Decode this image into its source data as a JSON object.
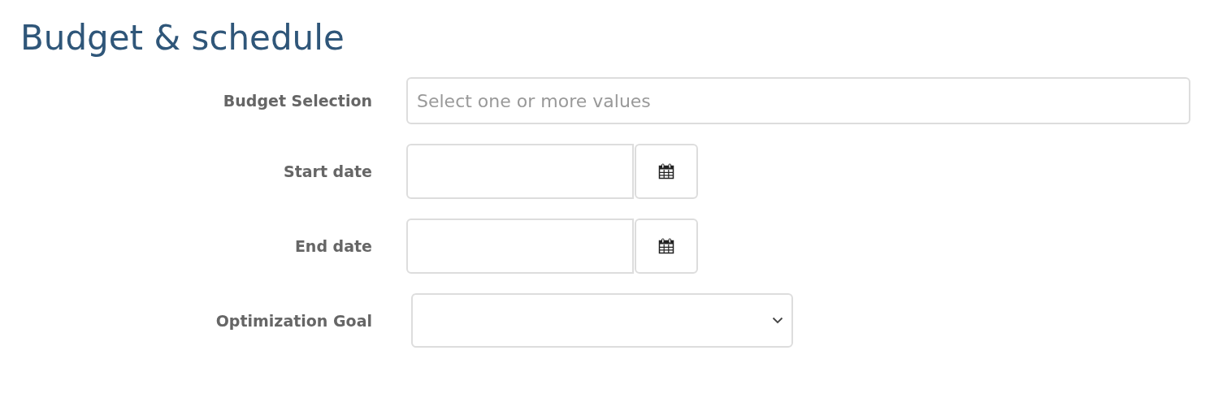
{
  "title": "Budget & schedule",
  "fields": [
    {
      "kind": "multiselect",
      "label": "Budget Selection",
      "placeholder": "Select one or more values"
    },
    {
      "kind": "date",
      "label": "Start date"
    },
    {
      "kind": "date",
      "label": "End date"
    },
    {
      "kind": "select",
      "label": "Optimization Goal"
    }
  ]
}
